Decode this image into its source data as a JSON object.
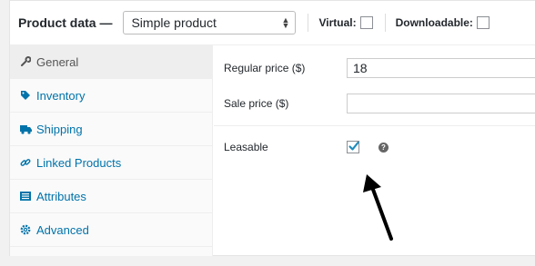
{
  "header": {
    "title": "Product data —",
    "product_type": "Simple product",
    "virtual_label": "Virtual:",
    "downloadable_label": "Downloadable:"
  },
  "sidebar": {
    "items": [
      {
        "label": "General",
        "icon": "wrench-icon",
        "active": true
      },
      {
        "label": "Inventory",
        "icon": "tag-icon"
      },
      {
        "label": "Shipping",
        "icon": "truck-icon"
      },
      {
        "label": "Linked Products",
        "icon": "link-icon"
      },
      {
        "label": "Attributes",
        "icon": "list-icon"
      },
      {
        "label": "Advanced",
        "icon": "gear-icon"
      }
    ]
  },
  "general": {
    "regular_price_label": "Regular price ($)",
    "regular_price_value": "18",
    "sale_price_label": "Sale price ($)",
    "sale_price_value": "",
    "leasable_label": "Leasable",
    "leasable_checked": true,
    "help_glyph": "?"
  },
  "colors": {
    "link": "#0073aa",
    "checkmark": "#1e8cbe",
    "annotation_arrow": "#000000"
  }
}
